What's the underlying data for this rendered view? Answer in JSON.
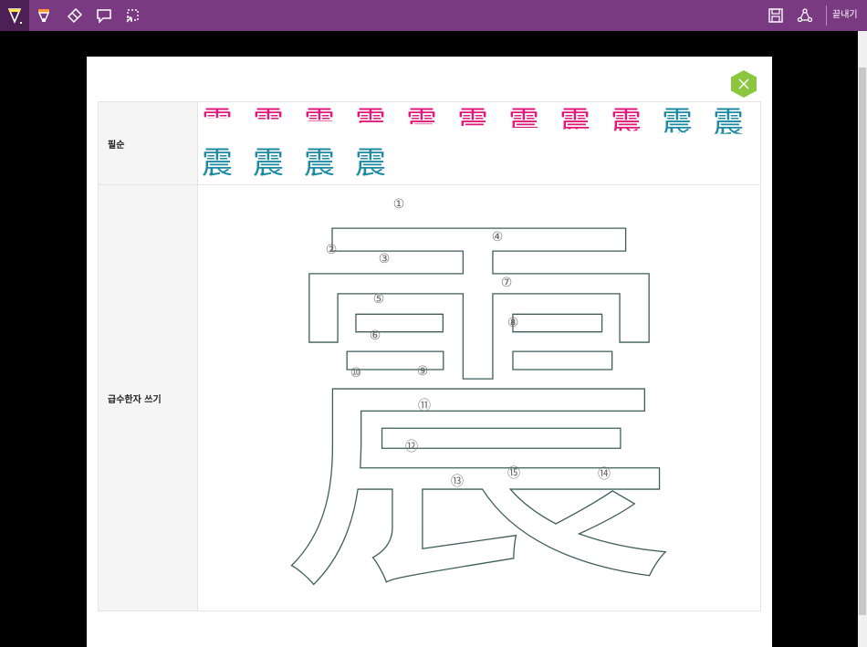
{
  "toolbar": {
    "tools": [
      {
        "name": "ballpoint-pen",
        "icon": "pen-icon",
        "active": true
      },
      {
        "name": "highlighter",
        "icon": "highlighter-icon",
        "active": false
      },
      {
        "name": "eraser",
        "icon": "eraser-icon",
        "active": false
      },
      {
        "name": "add-note",
        "icon": "comment-icon",
        "active": false
      },
      {
        "name": "clip",
        "icon": "clip-icon",
        "active": false
      }
    ],
    "save_icon": "save-icon",
    "share_icon": "share-icon",
    "exit_label": "끝내기",
    "color": "#7a3a82"
  },
  "dialog": {
    "close_icon": "close-icon",
    "close_color": "#8cc63f"
  },
  "table": {
    "stroke_order_label": "필순",
    "practice_label": "급수한자 쓰기",
    "character": "震",
    "stroke_count": 15,
    "stroke_color": "#e0187b",
    "previous_color": "#1d8aa3",
    "stroke_numbers": [
      "①",
      "②",
      "③",
      "④",
      "⑤",
      "⑥",
      "⑦",
      "⑧",
      "⑨",
      "⑩",
      "⑪",
      "⑫",
      "⑬",
      "⑭",
      "⑮"
    ]
  }
}
